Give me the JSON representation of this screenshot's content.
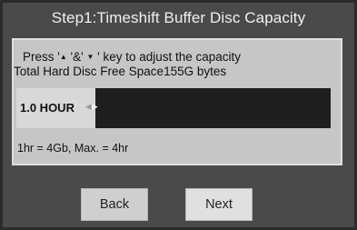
{
  "title": "Step1:Timeshift Buffer Disc Capacity",
  "instruction": {
    "prefix": "Press '",
    "up_symbol": "▲",
    "middle": " '&' ",
    "down_symbol": "▼",
    "suffix": " ' key to adjust the capacity"
  },
  "free_space": "Total Hard Disc Free Space155G  bytes",
  "capacity": {
    "label": "1.0 HOUR",
    "level_fraction": 0.25,
    "left_arrow": "◀",
    "right_arrow": "▶"
  },
  "note": "1hr = 4Gb, Max. = 4hr",
  "buttons": {
    "back": "Back",
    "next": "Next"
  },
  "colors": {
    "background": "#4a4a4a",
    "panel": "#c6c6c6",
    "bar_empty": "#1f1f1f",
    "bar_fill": "#d8d8d8"
  }
}
